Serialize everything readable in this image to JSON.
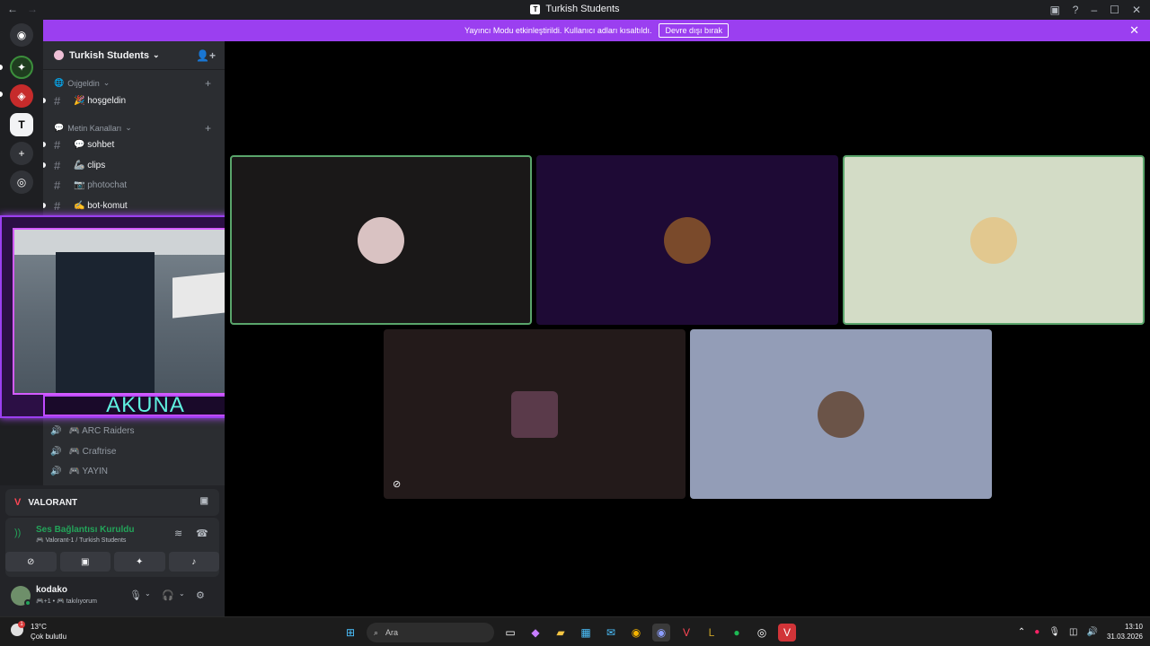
{
  "window": {
    "title": "Turkish Students",
    "title_icon": "T"
  },
  "banner": {
    "text": "Yayıncı Modu etkinleştirildi. Kullanıcı adları kısaltıldı.",
    "button": "Devre dışı bırak"
  },
  "server": {
    "name": "Turkish Students"
  },
  "categories": {
    "welcome": "Oıjgeldin",
    "text": "Metin Kanalları"
  },
  "channels": {
    "c1": "🎉 hoşgeldin",
    "c2": "💬 sohbet",
    "c3": "🦾 clips",
    "c4": "📷 photochat",
    "c5": "✍️ bot-komut"
  },
  "voice_channels": {
    "v1": "🎮 ARC Raiders",
    "v2": "🎮 Craftrise",
    "v3": "🎮 YAYIN"
  },
  "overlay": {
    "name": "AKUNA"
  },
  "activity": {
    "game": "VALORANT"
  },
  "voice": {
    "status": "Ses Bağlantısı Kuruldu",
    "where": "🎮 Valorant-1 / Turkish Students"
  },
  "user": {
    "name": "kodako",
    "status": "🎮+1 • 🎮 takılıyorum"
  },
  "taskbar": {
    "temp": "13°C",
    "weather": "Çok bulutlu",
    "search": "Ara",
    "weather_badge": "1",
    "time": "13:10",
    "date": "31.03.2026"
  },
  "colors": {
    "accent": "#9b3ff0",
    "speaking": "#5aa56b",
    "connected": "#23a55a"
  }
}
